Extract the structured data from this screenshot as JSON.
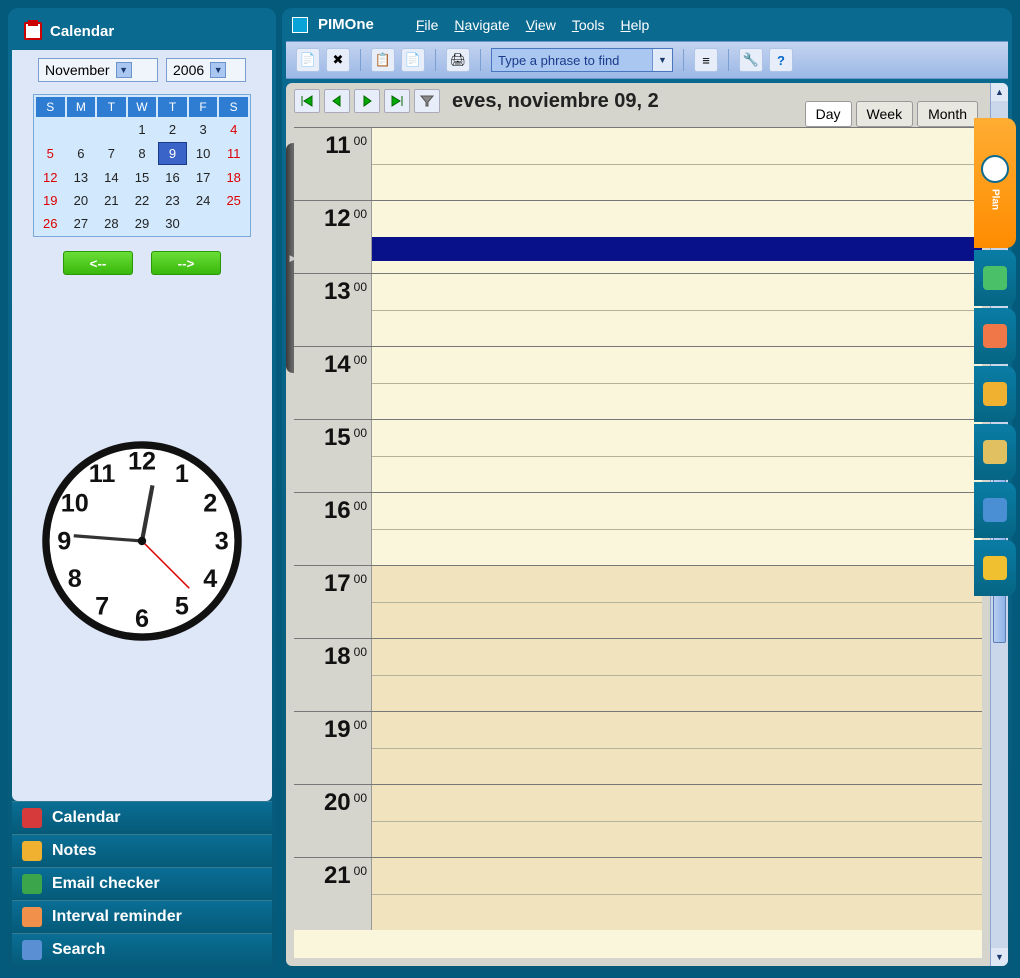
{
  "app": {
    "title": "PIMOne"
  },
  "menus": [
    {
      "html": "<span class='ul'>F</span>ile"
    },
    {
      "html": "<span class='ul'>N</span>avigate"
    },
    {
      "html": "<span class='ul'>V</span>iew"
    },
    {
      "html": "<span class='ul'>T</span>ools"
    },
    {
      "html": "<span class='ul'>H</span>elp"
    }
  ],
  "search": {
    "placeholder": "Type a phrase to find"
  },
  "sidebar": {
    "header": "Calendar",
    "month": "November",
    "year": "2006",
    "dow": [
      "S",
      "M",
      "T",
      "W",
      "T",
      "F",
      "S"
    ],
    "weeks": [
      [
        "",
        "",
        "",
        "1",
        "2",
        "3",
        "4"
      ],
      [
        "5",
        "6",
        "7",
        "8",
        "9",
        "10",
        "11"
      ],
      [
        "12",
        "13",
        "14",
        "15",
        "16",
        "17",
        "18"
      ],
      [
        "19",
        "20",
        "21",
        "22",
        "23",
        "24",
        "25"
      ],
      [
        "26",
        "27",
        "28",
        "29",
        "30",
        "",
        ""
      ]
    ],
    "today": "9",
    "prev": "<--",
    "next": "-->",
    "nav": [
      {
        "label": "Calendar",
        "color": "#fff",
        "icon_bg": "#d63a3a"
      },
      {
        "label": "Notes",
        "color": "#fff",
        "icon_bg": "#f0b030"
      },
      {
        "label": "Email checker",
        "color": "#fff",
        "icon_bg": "#3aa54a"
      },
      {
        "label": "Interval reminder",
        "color": "#fff",
        "icon_bg": "#f0904a"
      },
      {
        "label": "Search",
        "color": "#fff",
        "icon_bg": "#5a8fd4"
      }
    ]
  },
  "day": {
    "date_label": "eves, noviembre 09, 2",
    "views": [
      "Day",
      "Week",
      "Month"
    ],
    "active_view": "Day",
    "hours": [
      11,
      12,
      13,
      14,
      15,
      16,
      17,
      18,
      19,
      20,
      21
    ],
    "pm_start": 17,
    "current_hour": 12
  },
  "side_tabs": {
    "active": {
      "label": "Plan"
    },
    "others": [
      {
        "name": "todo",
        "bg": "#4ac068"
      },
      {
        "name": "contacts",
        "bg": "#f07848"
      },
      {
        "name": "users",
        "bg": "#f0b030"
      },
      {
        "name": "lock",
        "bg": "#e0c060"
      },
      {
        "name": "folder",
        "bg": "#4a8fd4"
      },
      {
        "name": "star",
        "bg": "#f0c030"
      }
    ]
  }
}
